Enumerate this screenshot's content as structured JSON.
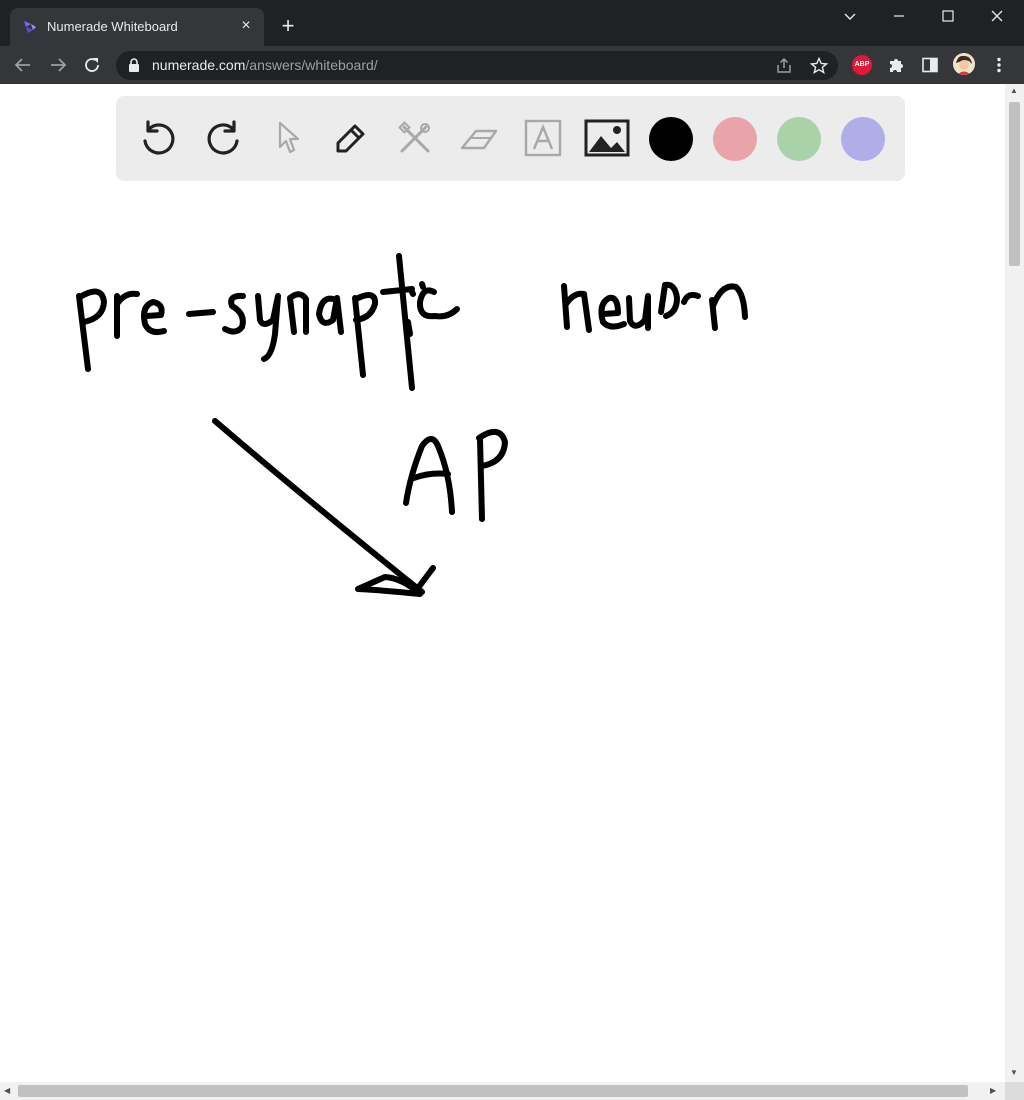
{
  "browser": {
    "tab_title": "Numerade Whiteboard",
    "new_tab_symbol": "+",
    "tab_close_symbol": "×",
    "url_host": "numerade.com",
    "url_path": "/answers/whiteboard/",
    "extension_abp": "ABP"
  },
  "whiteboard": {
    "tools": [
      "undo-icon",
      "redo-icon",
      "select-pointer-icon",
      "pen-icon",
      "tools-icon",
      "eraser-icon",
      "text-icon",
      "image-icon"
    ],
    "colors": [
      "#000000",
      "#e8a3ab",
      "#a9d2a9",
      "#b0aee8"
    ],
    "handwriting": [
      "pre-synaptic",
      "neuron",
      "AP"
    ]
  }
}
